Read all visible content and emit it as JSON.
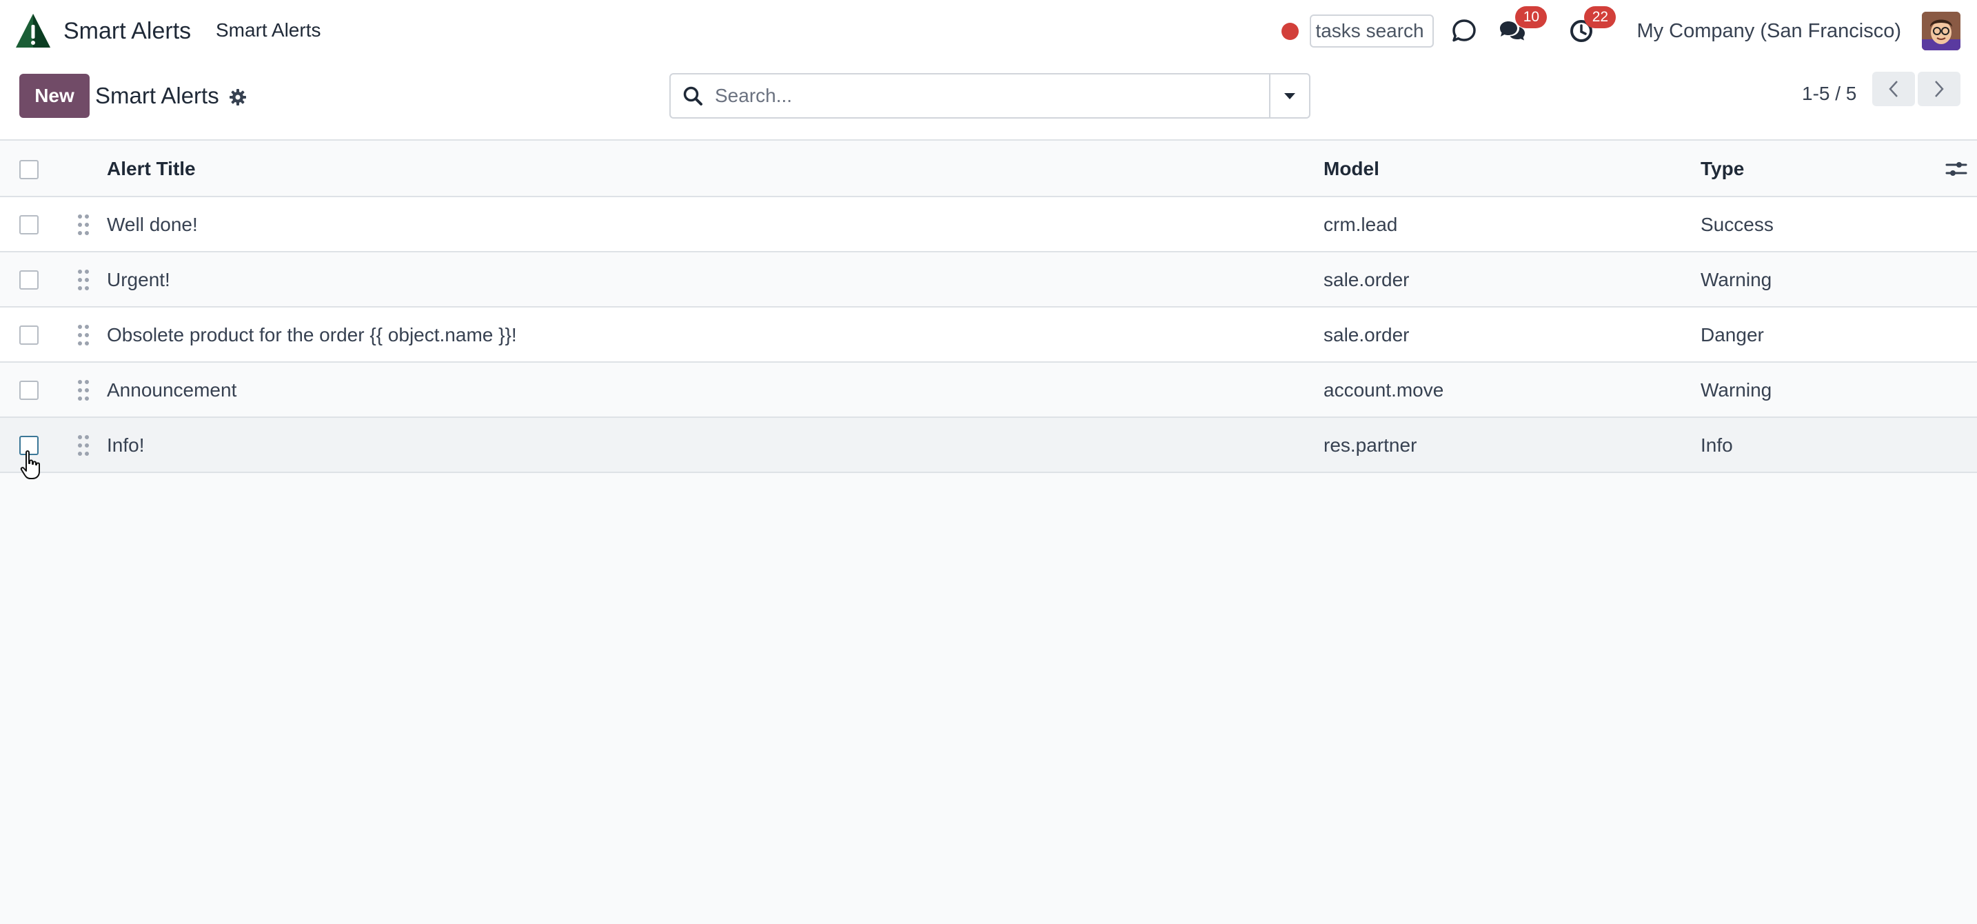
{
  "app": {
    "brand_name": "Smart Alerts",
    "menu_item": "Smart Alerts",
    "logo_icon": "warning-triangle-logo-icon"
  },
  "navbar": {
    "recording_indicator_color": "#d23f3a",
    "tasks_search_placeholder": "tasks search",
    "discuss_icon": "discuss-icon",
    "messages": {
      "icon": "chat-icon",
      "count": "10"
    },
    "activities": {
      "icon": "clock-icon",
      "count": "22"
    },
    "company": "My Company (San Francisco)",
    "avatar_icon": "user-avatar"
  },
  "control_panel": {
    "new_label": "New",
    "title": "Smart Alerts",
    "gear_icon": "gear-icon",
    "search_placeholder": "Search...",
    "pager_value": "1-5 / 5"
  },
  "table": {
    "columns": {
      "title": "Alert Title",
      "model": "Model",
      "type": "Type"
    },
    "rows": [
      {
        "title": "Well done!",
        "model": "crm.lead",
        "type": "Success"
      },
      {
        "title": "Urgent!",
        "model": "sale.order",
        "type": "Warning"
      },
      {
        "title": "Obsolete product for the order {{ object.name }}!",
        "model": "sale.order",
        "type": "Danger"
      },
      {
        "title": "Announcement",
        "model": "account.move",
        "type": "Warning"
      },
      {
        "title": "Info!",
        "model": "res.partner",
        "type": "Info"
      }
    ]
  },
  "colors": {
    "brand_primary": "#714b67",
    "badge": "#d23f3a",
    "background": "#f9fafb"
  }
}
